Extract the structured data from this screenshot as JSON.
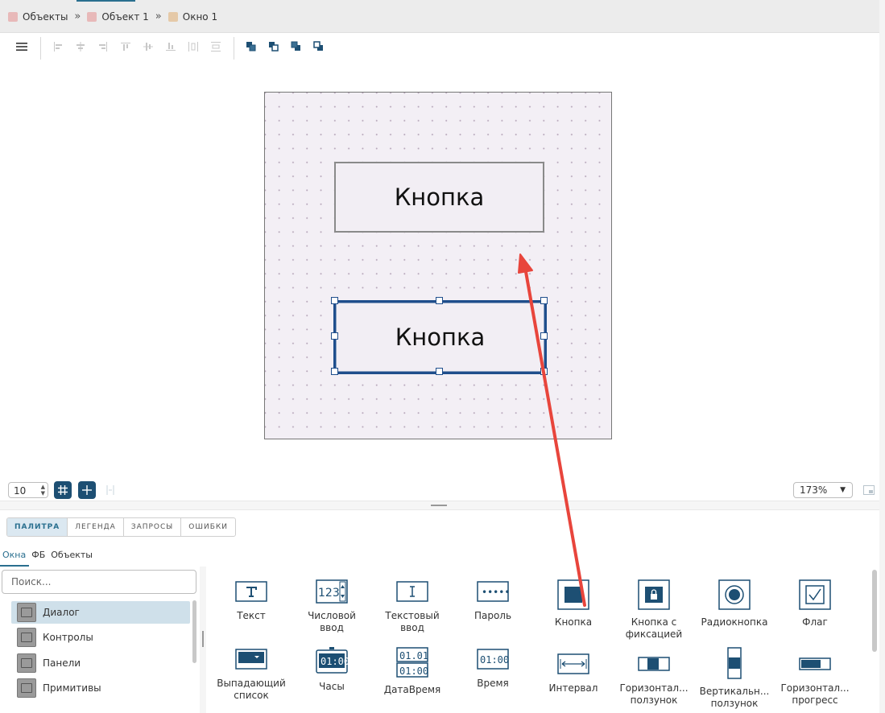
{
  "breadcrumb": [
    {
      "label": "Объекты",
      "color": "#e8b9b9"
    },
    {
      "label": "Объект 1",
      "color": "#e8b9b9"
    },
    {
      "label": "Окно 1",
      "color": "#e5c9a8"
    }
  ],
  "breadcrumb_separator": "»",
  "canvas": {
    "button_top_label": "Кнопка",
    "button_bottom_label": "Кнопка"
  },
  "grid_step": "10",
  "zoom": "173%",
  "panel_tabs": [
    "ПАЛИТРА",
    "ЛЕГЕНДА",
    "ЗАПРОСЫ",
    "ОШИБКИ"
  ],
  "sub_tabs": [
    "Окна",
    "ФБ",
    "Объекты"
  ],
  "search_placeholder": "Поиск...",
  "categories": [
    "Диалог",
    "Контролы",
    "Панели",
    "Примитивы"
  ],
  "palette": [
    {
      "label": "Текст",
      "icon": "text-icon"
    },
    {
      "label": "Числовой\nввод",
      "icon": "numeric-input-icon"
    },
    {
      "label": "Текстовый\nввод",
      "icon": "text-input-icon"
    },
    {
      "label": "Пароль",
      "icon": "password-icon"
    },
    {
      "label": "Кнопка",
      "icon": "button-icon"
    },
    {
      "label": "Кнопка с\nфиксацией",
      "icon": "toggle-button-icon"
    },
    {
      "label": "Радиокнопка",
      "icon": "radio-icon"
    },
    {
      "label": "Флаг",
      "icon": "checkbox-icon"
    },
    {
      "label": "Выпадающий\nсписок",
      "icon": "dropdown-icon"
    },
    {
      "label": "Часы",
      "icon": "clock-icon"
    },
    {
      "label": "ДатаВремя",
      "icon": "datetime-icon"
    },
    {
      "label": "Время",
      "icon": "time-icon"
    },
    {
      "label": "Интервал",
      "icon": "interval-icon"
    },
    {
      "label": "Горизонтал...\nползунок",
      "icon": "hslider-icon"
    },
    {
      "label": "Вертикальн...\nползунок",
      "icon": "vslider-icon"
    },
    {
      "label": "Горизонтал...\nпрогресс",
      "icon": "hprogress-icon"
    }
  ],
  "clock_digits": "01:00",
  "date_digits": "01.01",
  "num_digits": "123",
  "password_dots": "•••••",
  "colors": {
    "accent": "#1d4f73",
    "arrow": "#e8453c",
    "selection": "#1f4e8c"
  }
}
